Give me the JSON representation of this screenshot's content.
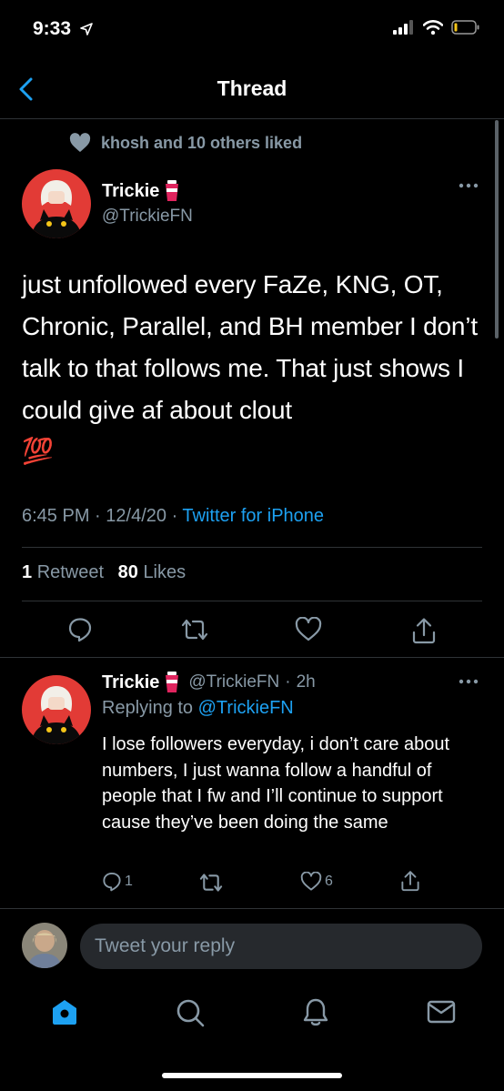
{
  "status_bar": {
    "time": "9:33"
  },
  "nav": {
    "title": "Thread"
  },
  "social_context": {
    "text": "khosh and 10 others liked"
  },
  "tweet": {
    "display_name": "Trickie",
    "handle": "@TrickieFN",
    "text": "just unfollowed every FaZe, KNG, OT, Chronic, Parallel, and BH member I don’t talk to that follows me. That just shows I could give af about clout",
    "emoji": "💯",
    "time": "6:45 PM",
    "date": "12/4/20",
    "source": "Twitter for iPhone",
    "retweets": {
      "count": "1",
      "label": "Retweet"
    },
    "likes": {
      "count": "80",
      "label": "Likes"
    }
  },
  "reply": {
    "display_name": "Trickie",
    "handle": "@TrickieFN",
    "age": "2h",
    "replying_to_label": "Replying to",
    "replying_to_handle": "@TrickieFN",
    "text": "I lose followers everyday, i don’t care about numbers, I just wanna follow a handful of people that I fw and I’ll continue to support cause they’ve been doing the same",
    "reply_count": "1",
    "like_count": "6"
  },
  "composer": {
    "placeholder": "Tweet your reply"
  },
  "colors": {
    "accent": "#1da1f2",
    "muted": "#8899a6",
    "emoji_red": "#e0245e"
  }
}
